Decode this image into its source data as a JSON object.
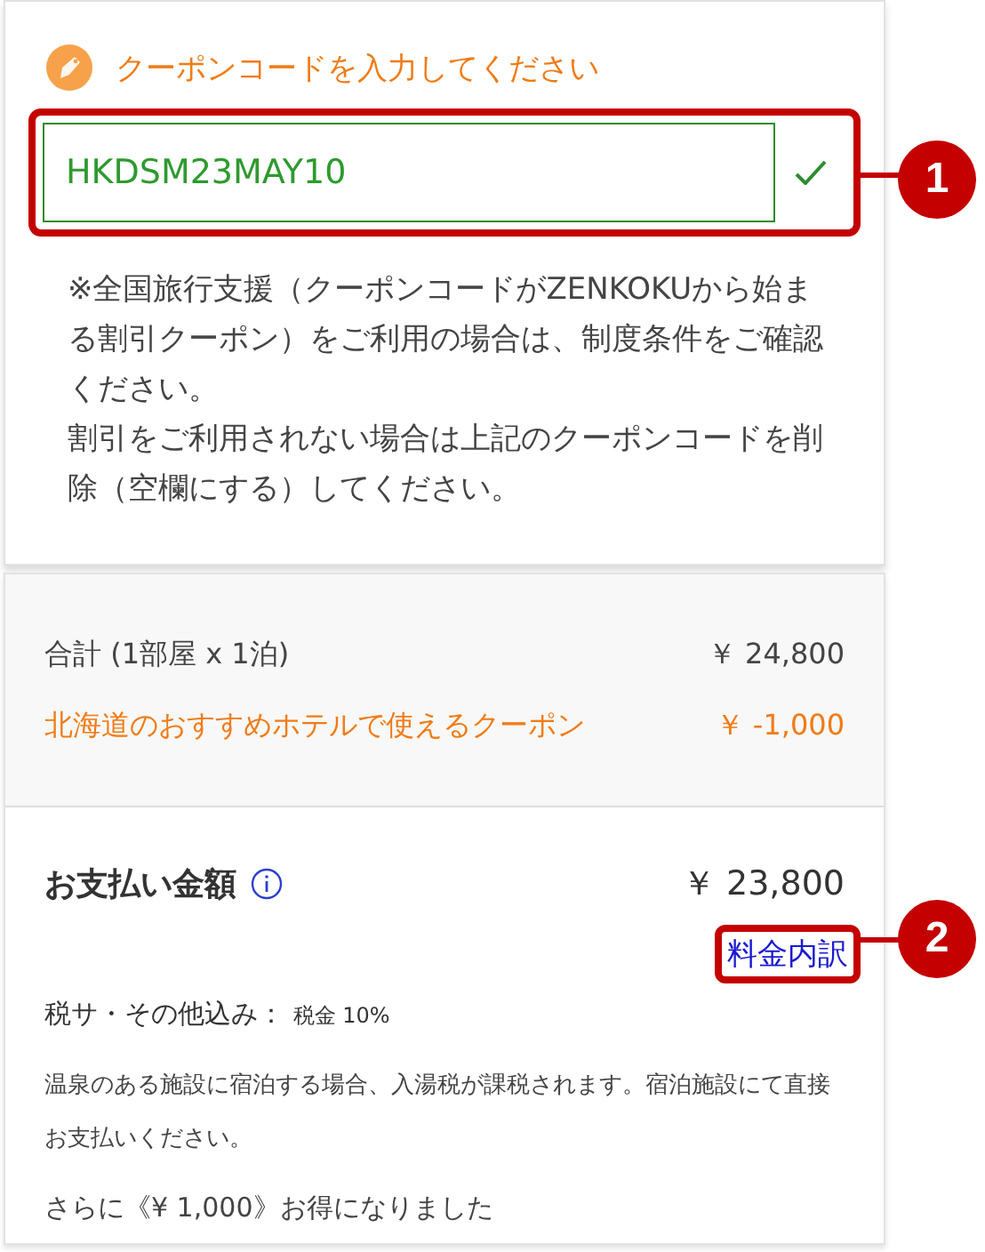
{
  "coupon": {
    "label": "クーポンコードを入力してください",
    "value": "HKDSM23MAY10",
    "valid": true,
    "note": [
      "※全国旅行支援（クーポンコードがZENKOKUから始まる割引クーポン）をご利用の場合は、制度条件をご確認ください。",
      "割引をご利用されない場合は上記のクーポンコードを削除（空欄にする）してください。"
    ]
  },
  "summary": {
    "rows": [
      {
        "kind": "subtotal",
        "label": "合計 (1部屋 x 1泊)",
        "amount": "￥ 24,800"
      },
      {
        "kind": "discount",
        "label": "北海道のおすすめホテルで使えるクーポン",
        "amount": "￥ -1,000"
      }
    ]
  },
  "payment": {
    "label": "お支払い金額",
    "amount": "￥ 23,800",
    "breakdown_link": "料金内訳",
    "tax_label": "税サ・その他込み：",
    "tax_detail": "税金 10%",
    "notice": "温泉のある施設に宿泊する場合、入湯税が課税されます。宿泊施設にて直接お支払いください。",
    "savings": "さらに《¥ 1,000》お得になりました"
  },
  "callouts": [
    "1",
    "2"
  ]
}
